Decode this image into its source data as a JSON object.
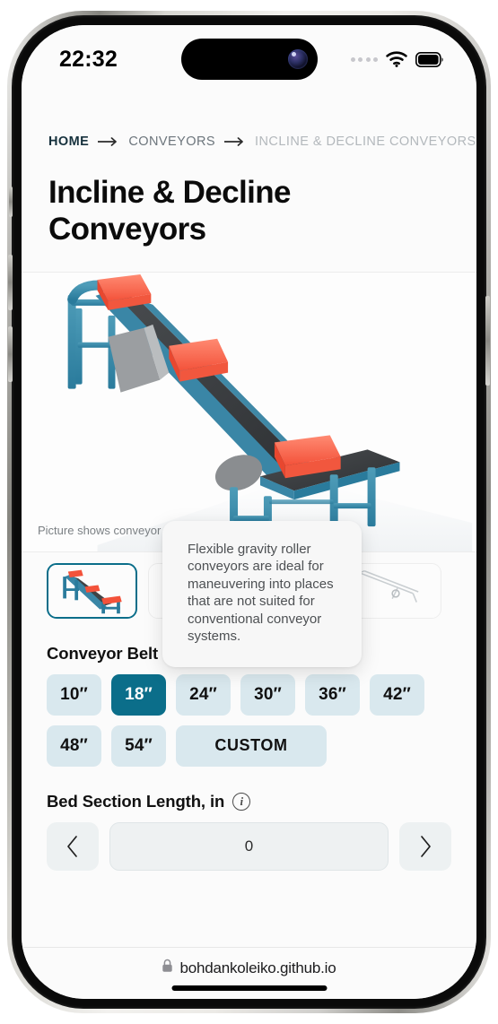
{
  "status_bar": {
    "time": "22:32",
    "signal_icon": "signal-dots-icon",
    "wifi_icon": "wifi-icon",
    "battery_icon": "battery-full-icon"
  },
  "breadcrumb": {
    "items": [
      {
        "label": "HOME",
        "state": "link"
      },
      {
        "label": "CONVEYORS",
        "state": "link"
      },
      {
        "label": "INCLINE & DECLINE CONVEYORS",
        "state": "current"
      }
    ],
    "separator_icon": "arrow-right-icon"
  },
  "page": {
    "title": "Incline & Decline Conveyors"
  },
  "hero": {
    "image_alt": "incline-decline-conveyor-render",
    "caption": "Picture shows conveyor with optional structures amd fea"
  },
  "thumbnails": [
    {
      "name": "incline-conveyor-thumb",
      "selected": true
    },
    {
      "name": "conveyor-thumb-2",
      "selected": false
    },
    {
      "name": "horizontal-conveyor-thumb",
      "selected": false
    },
    {
      "name": "schematic-conveyor-thumb",
      "selected": false
    }
  ],
  "tooltip": {
    "text": "Flexible gravity roller conveyors are ideal for maneuvering into places that are not suited for conventional conveyor systems."
  },
  "options": {
    "belt_width": {
      "label": "Conveyor Belt Width, in",
      "info_icon": "info-icon",
      "selected": "18″",
      "choices": [
        "10″",
        "18″",
        "24″",
        "30″",
        "36″",
        "42″",
        "48″",
        "54″",
        "CUSTOM"
      ]
    },
    "bed_length": {
      "label": "Bed Section Length, in",
      "info_icon": "info-icon",
      "value": "0",
      "prev_icon": "chevron-left-icon",
      "next_icon": "chevron-right-icon"
    }
  },
  "browser": {
    "lock_icon": "lock-icon",
    "url": "bohdankoleiko.github.io"
  },
  "colors": {
    "accent_teal": "#0b6e8a",
    "chip_bg": "#d9e8ee",
    "page_bg": "#fbfbfb"
  }
}
